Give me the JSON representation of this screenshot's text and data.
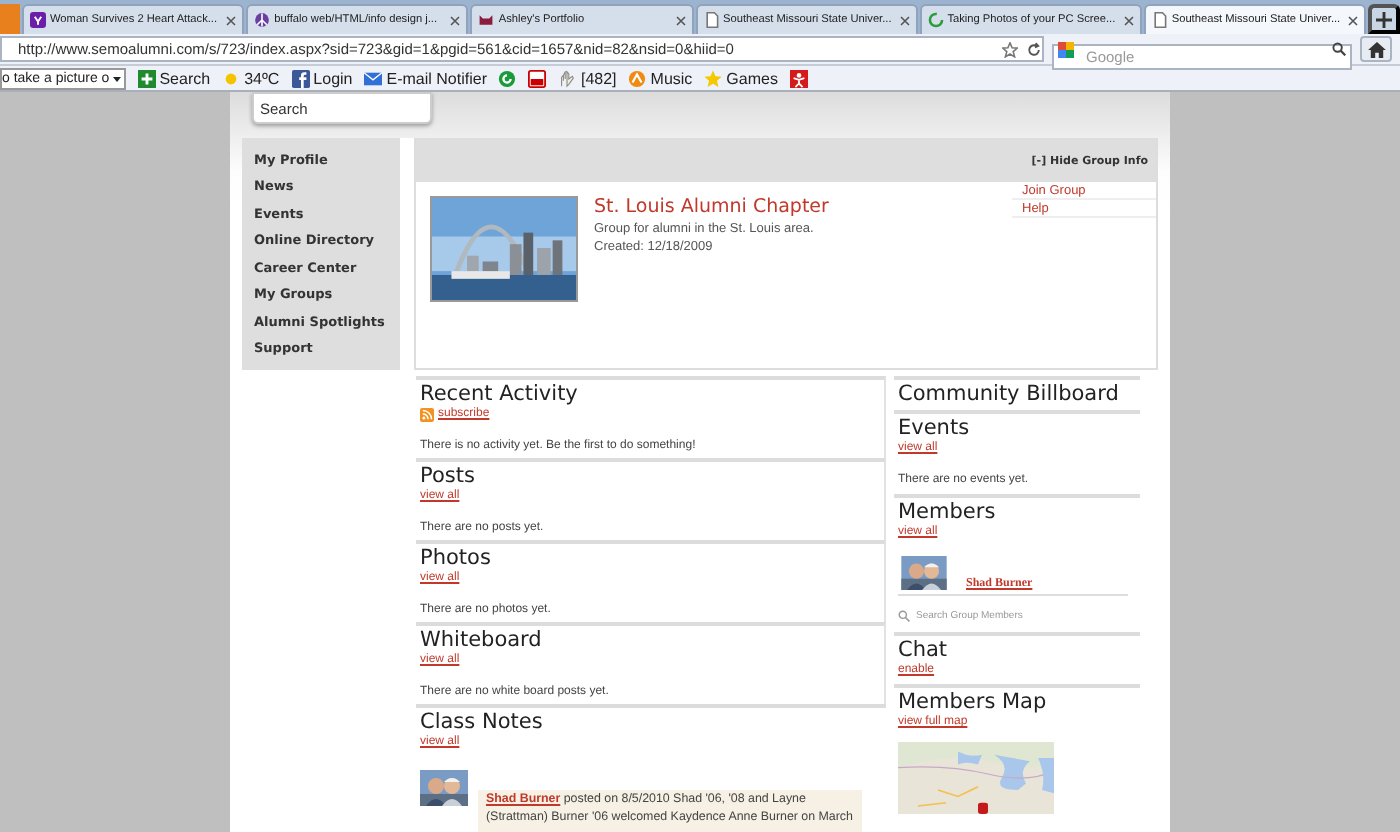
{
  "browser": {
    "tabs": [
      {
        "title": "Woman Survives 2 Heart Attack...",
        "selected": false
      },
      {
        "title": "buffalo web/HTML/info design j...",
        "selected": false
      },
      {
        "title": "Ashley's Portfolio",
        "selected": false
      },
      {
        "title": "Southeast Missouri State Univer...",
        "selected": false
      },
      {
        "title": "Taking Photos of your PC Scree...",
        "selected": false
      },
      {
        "title": "Southeast Missouri State Univer...",
        "selected": true
      }
    ],
    "url": "http://www.semoalumni.com/s/723/index.aspx?sid=723&gid=1&pgid=561&cid=1657&nid=82&nsid=0&hiid=0",
    "search": {
      "placeholder": "Google"
    },
    "toolbar": [
      {
        "kind": "combo",
        "label": "o take a picture o"
      },
      {
        "kind": "search",
        "label": "Search"
      },
      {
        "kind": "weather",
        "label": "34ºC"
      },
      {
        "kind": "facebook",
        "label": "Login"
      },
      {
        "kind": "mail",
        "label": "E-mail Notifier"
      },
      {
        "kind": "swirl"
      },
      {
        "kind": "video"
      },
      {
        "kind": "hand",
        "label": "[482]"
      },
      {
        "kind": "music",
        "label": "Music"
      },
      {
        "kind": "star",
        "label": "Games"
      },
      {
        "kind": "gift"
      }
    ]
  },
  "page": {
    "search": {
      "placeholder": "Search"
    },
    "nav": [
      {
        "label": "My Profile"
      },
      {
        "label": "News"
      },
      {
        "label": "Events"
      },
      {
        "label": "Online Directory"
      },
      {
        "label": "Career Center"
      },
      {
        "label": "My Groups"
      },
      {
        "label": "Alumni Spotlights"
      },
      {
        "label": "Support"
      }
    ],
    "group": {
      "toggle": "[-] Hide Group Info",
      "name": "St. Louis Alumni Chapter",
      "description": "Group for alumni in the St. Louis area.",
      "created": "Created: 12/18/2009",
      "actions": [
        "Join Group",
        "Help"
      ]
    },
    "sections": [
      {
        "title": "Recent Activity",
        "link": "subscribe",
        "feed": true,
        "message": "There is no activity yet. Be the first to do something!"
      },
      {
        "title": "Posts",
        "link": "view all",
        "feed": false,
        "message": "There are no posts yet."
      },
      {
        "title": "Photos",
        "link": "view all",
        "feed": false,
        "message": "There are no photos yet."
      },
      {
        "title": "Whiteboard",
        "link": "view all",
        "feed": false,
        "message": "There are no white board posts yet."
      }
    ],
    "class_notes": {
      "title": "Class Notes",
      "link": "view all",
      "author": "Shad Burner",
      "text": " posted on 8/5/2010 Shad '06, '08 and Layne (Strattman) Burner '06 welcomed Kaydence Anne Burner on March"
    },
    "billboard": {
      "title": "Community Billboard",
      "blocks": [
        {
          "kind": "events",
          "title": "Events",
          "link": "view all",
          "message": "There are no events yet."
        },
        {
          "kind": "members",
          "title": "Members",
          "link": "view all",
          "member": "Shad Burner",
          "placeholder": "Search Group Members"
        },
        {
          "kind": "chat",
          "title": "Chat",
          "link": "enable"
        },
        {
          "kind": "map",
          "title": "Members Map",
          "link": "view full map"
        }
      ]
    }
  }
}
